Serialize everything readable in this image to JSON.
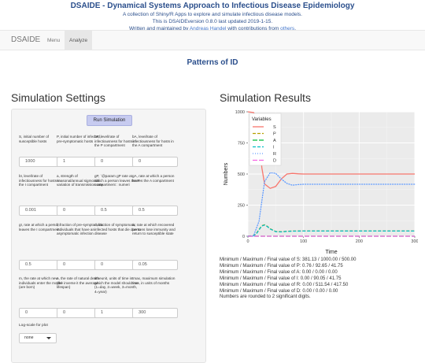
{
  "header": {
    "title": "DSAIDE - Dynamical Systems Approach to Infectious Disease Epidemiology",
    "subtitle": "A collection of Shiny/R Apps to explore and simulate infectious disease models.",
    "version_line": "This is DSAIDEversion 0.8.0 last updated 2019-1-15.",
    "credit_prefix": "Written and maintained by ",
    "credit_author": "Andreas Handel",
    "credit_mid": " with contributions from ",
    "credit_others": "others",
    "credit_end": "."
  },
  "navbar": {
    "brand": "DSAIDE",
    "items": [
      "Menu",
      "Analyze"
    ],
    "active": "Analyze"
  },
  "page_title": "Patterns of ID",
  "settings": {
    "title": "Simulation Settings",
    "run_button": "Run Simulation",
    "params": [
      {
        "label": "S, initial number of susceptible hosts",
        "value": "1000"
      },
      {
        "label": "P, initial number of infected, pre-symptomatic hosts",
        "value": "1"
      },
      {
        "label": "bP, level/rate of infectiousness for hosts in the P compartment",
        "value": "0"
      },
      {
        "label": "bA, level/rate of infectiousness for hosts in the A compartment",
        "value": "0"
      },
      {
        "label": "bI, level/rate of infectiousness for hosts in the I compartment",
        "value": "0.001"
      },
      {
        "label": "a, strength of seasonal/annual sigmoidal variation of transmission rate",
        "value": "0"
      },
      {
        "label": "gP, `@param gP rate at which a person leaves the P compartment : numeri",
        "value": "0.5"
      },
      {
        "label": "gA, rate at which a person leaves the A compartment",
        "value": "0.5"
      },
      {
        "label": "gI, rate at which a person leaves the I compartment",
        "value": "0.5"
      },
      {
        "label": "f, fraction of pre-symptomatic individuals that have an asymptomatic infection",
        "value": "0"
      },
      {
        "label": "d, fraction of symptomatic infected hosts that die due to disease",
        "value": "0"
      },
      {
        "label": "w, rate at which recovered persons lose immunity and return to susceptible state",
        "value": "0.05"
      },
      {
        "label": "m, the rate at which new individuals enter the model (are born)",
        "value": "0"
      },
      {
        "label": "n, the rate of natural death (the inverse it the average lifespan)",
        "value": "0"
      },
      {
        "label": "timeunit, units of time in which the model should run (1=day, 2=week, 3=month, 4=year)",
        "value": "1"
      },
      {
        "label": "tmax, maximum simulation time, in units of months",
        "value": "300"
      }
    ],
    "log_label": "Log-scale for plot",
    "log_value": "none"
  },
  "results": {
    "title": "Simulation Results",
    "lines": [
      "Minimum / Maximum / Final value of S: 381.13 / 1000.00 / 500.00",
      "Minimum / Maximum / Final value of P: 0.76 / 92.65 / 41.75",
      "Minimum / Maximum / Final value of A: 0.00 / 0.00 / 0.00",
      "Minimum / Maximum / Final value of I: 0.00 / 90.05 / 41.75",
      "Minimum / Maximum / Final value of R: 0.00 / 511.54 / 417.50",
      "Minimum / Maximum / Final value of D: 0.00 / 0.00 / 0.00",
      "Numbers are rounded to 2 significant digits."
    ]
  },
  "chart_data": {
    "type": "line",
    "xlabel": "Time",
    "ylabel": "Numbers",
    "xlim": [
      0,
      300
    ],
    "ylim": [
      0,
      1000
    ],
    "xticks": [
      0,
      100,
      200,
      300
    ],
    "yticks": [
      0,
      250,
      500,
      750,
      1000
    ],
    "legend_title": "Variables",
    "legend_position": "top-left",
    "grid": true,
    "series": [
      {
        "name": "S",
        "color": "#f8766d",
        "dash": "solid",
        "x": [
          0,
          10,
          15,
          20,
          25,
          30,
          40,
          50,
          60,
          70,
          80,
          90,
          100,
          120,
          150,
          200,
          250,
          300
        ],
        "y": [
          1000,
          995,
          960,
          800,
          550,
          420,
          385,
          400,
          460,
          500,
          505,
          502,
          500,
          500,
          500,
          500,
          500,
          500
        ]
      },
      {
        "name": "P",
        "color": "#b79f00",
        "dash": "dashed",
        "x": [
          0,
          10,
          15,
          20,
          25,
          30,
          35,
          40,
          50,
          60,
          70,
          80,
          100,
          150,
          200,
          300
        ],
        "y": [
          1,
          5,
          20,
          55,
          85,
          92,
          80,
          60,
          38,
          36,
          40,
          42,
          42,
          42,
          42,
          42
        ]
      },
      {
        "name": "A",
        "color": "#00ba38",
        "dash": "longdash",
        "x": [
          0,
          300
        ],
        "y": [
          0,
          0
        ]
      },
      {
        "name": "I",
        "color": "#00bfc4",
        "dash": "dashed",
        "x": [
          0,
          10,
          15,
          20,
          25,
          30,
          35,
          40,
          50,
          60,
          70,
          80,
          100,
          150,
          200,
          300
        ],
        "y": [
          0,
          4,
          18,
          52,
          83,
          90,
          78,
          58,
          37,
          35,
          39,
          41,
          42,
          42,
          42,
          42
        ]
      },
      {
        "name": "R",
        "color": "#619cff",
        "dash": "dotted",
        "x": [
          0,
          10,
          20,
          30,
          40,
          50,
          60,
          70,
          80,
          90,
          100,
          150,
          200,
          300
        ],
        "y": [
          0,
          2,
          120,
          440,
          510,
          505,
          460,
          425,
          410,
          415,
          418,
          418,
          418,
          418
        ]
      },
      {
        "name": "D",
        "color": "#f564e3",
        "dash": "longdash",
        "x": [
          0,
          300
        ],
        "y": [
          0,
          0
        ]
      }
    ]
  }
}
